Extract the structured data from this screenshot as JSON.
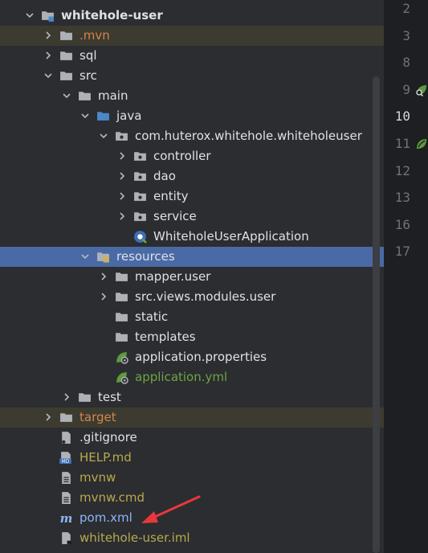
{
  "tree": {
    "items": [
      {
        "label": "whitehole-user",
        "icon": "module-folder-icon",
        "arrow": "down",
        "style": "bold",
        "level": 0
      },
      {
        "label": ".mvn",
        "icon": "folder-icon",
        "arrow": "right",
        "style": "orange",
        "level": 1,
        "excluded": true
      },
      {
        "label": "sql",
        "icon": "folder-icon",
        "arrow": "right",
        "style": "",
        "level": 1
      },
      {
        "label": "src",
        "icon": "folder-icon",
        "arrow": "down",
        "style": "",
        "level": 1
      },
      {
        "label": "main",
        "icon": "folder-icon",
        "arrow": "down",
        "style": "",
        "level": 2
      },
      {
        "label": "java",
        "icon": "source-folder-icon",
        "arrow": "down",
        "style": "",
        "level": 3
      },
      {
        "label": "com.huterox.whitehole.whiteholeuser",
        "icon": "package-icon",
        "arrow": "down",
        "style": "",
        "level": 4
      },
      {
        "label": "controller",
        "icon": "package-icon",
        "arrow": "right",
        "style": "",
        "level": 5
      },
      {
        "label": "dao",
        "icon": "package-icon",
        "arrow": "right",
        "style": "",
        "level": 5
      },
      {
        "label": "entity",
        "icon": "package-icon",
        "arrow": "right",
        "style": "",
        "level": 5
      },
      {
        "label": "service",
        "icon": "package-icon",
        "arrow": "right",
        "style": "",
        "level": 5
      },
      {
        "label": "WhiteholeUserApplication",
        "icon": "spring-boot-class-icon",
        "arrow": "none",
        "style": "",
        "level": 5
      },
      {
        "label": "resources",
        "icon": "resources-folder-icon",
        "arrow": "down",
        "style": "",
        "level": 3,
        "selected": true
      },
      {
        "label": "mapper.user",
        "icon": "folder-icon",
        "arrow": "right",
        "style": "",
        "level": 4
      },
      {
        "label": "src.views.modules.user",
        "icon": "folder-icon",
        "arrow": "right",
        "style": "",
        "level": 4
      },
      {
        "label": "static",
        "icon": "folder-icon",
        "arrow": "none",
        "style": "",
        "level": 4
      },
      {
        "label": "templates",
        "icon": "folder-icon",
        "arrow": "none",
        "style": "",
        "level": 4
      },
      {
        "label": "application.properties",
        "icon": "spring-config-icon",
        "arrow": "none",
        "style": "",
        "level": 4
      },
      {
        "label": "application.yml",
        "icon": "spring-config-icon",
        "arrow": "none",
        "style": "green",
        "level": 4
      },
      {
        "label": "test",
        "icon": "folder-icon",
        "arrow": "right",
        "style": "",
        "level": 2
      },
      {
        "label": "target",
        "icon": "folder-icon",
        "arrow": "right",
        "style": "orange",
        "level": 1,
        "excluded": true
      },
      {
        "label": ".gitignore",
        "icon": "gitignore-file-icon",
        "arrow": "none",
        "style": "",
        "level": 1
      },
      {
        "label": "HELP.md",
        "icon": "markdown-file-icon",
        "arrow": "none",
        "style": "olive",
        "level": 1
      },
      {
        "label": "mvnw",
        "icon": "text-file-icon",
        "arrow": "none",
        "style": "olive",
        "level": 1
      },
      {
        "label": "mvnw.cmd",
        "icon": "text-file-icon",
        "arrow": "none",
        "style": "olive",
        "level": 1
      },
      {
        "label": "pom.xml",
        "icon": "maven-file-icon",
        "arrow": "none",
        "style": "blue",
        "level": 1
      },
      {
        "label": "whitehole-user.iml",
        "icon": "iml-file-icon",
        "arrow": "none",
        "style": "olive",
        "level": 1
      }
    ]
  },
  "gutter": {
    "lines": [
      "2",
      "3",
      "8",
      "9",
      "10",
      "11",
      "12",
      "13",
      "16",
      "17"
    ],
    "current_line": "10",
    "icons": [
      {
        "line": "9",
        "name": "spring-bean-search-icon"
      },
      {
        "line": "11",
        "name": "spring-bean-icon"
      }
    ]
  },
  "colors": {
    "tree_bg": "#2b2d30",
    "selected_bg": "#4a6aa5",
    "excluded_bg": "#3d3b30",
    "excluded_text": "#d2854b",
    "modified_text": "#6da544",
    "unversioned_text": "#b9a94e",
    "annotation_arrow": "#e8383d"
  }
}
